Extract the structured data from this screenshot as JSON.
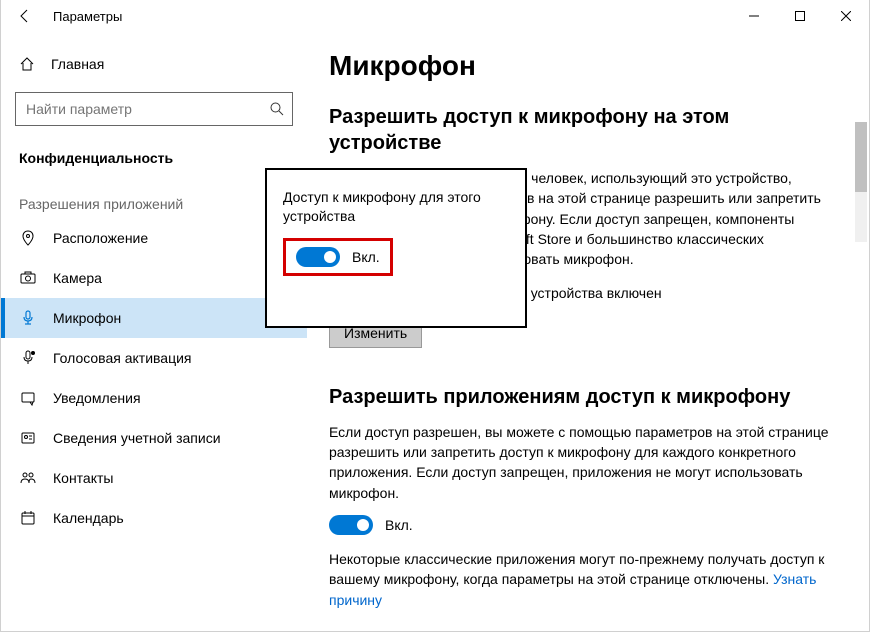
{
  "titlebar": {
    "title": "Параметры"
  },
  "sidebar": {
    "home": "Главная",
    "search_placeholder": "Найти параметр",
    "section": "Конфиденциальность",
    "group": "Разрешения приложений",
    "items": [
      {
        "label": "Расположение"
      },
      {
        "label": "Камера"
      },
      {
        "label": "Микрофон"
      },
      {
        "label": "Голосовая активация"
      },
      {
        "label": "Уведомления"
      },
      {
        "label": "Сведения учетной записи"
      },
      {
        "label": "Контакты"
      },
      {
        "label": "Календарь"
      }
    ]
  },
  "content": {
    "h1": "Микрофон",
    "section1": {
      "h2": "Разрешить доступ к микрофону на этом устройстве",
      "para": "Если доступ разрешен, любой человек, использующий это устройство, сможет с помощью параметров на этой странице разрешить или запретить приложениям доступ к микрофону. Если доступ запрещен, компоненты Windows, приложения Microsoft Store и большинство классических приложений не могут использовать микрофон.",
      "status": "Доступ к микрофону для этого устройства включен",
      "change_btn": "Изменить"
    },
    "section2": {
      "h2": "Разрешить приложениям доступ к микрофону",
      "para": "Если доступ разрешен, вы можете с помощью параметров на этой странице разрешить или запретить доступ к микрофону для каждого конкретного приложения. Если доступ запрещен, приложения не могут использовать микрофон.",
      "toggle_label": "Вкл.",
      "note_pre": "Некоторые классические приложения могут по-прежнему получать доступ к вашему микрофону, когда параметры на этой странице отключены. ",
      "note_link": "Узнать причину"
    }
  },
  "callout": {
    "text": "Доступ к микрофону для этого устройства",
    "toggle_label": "Вкл."
  }
}
